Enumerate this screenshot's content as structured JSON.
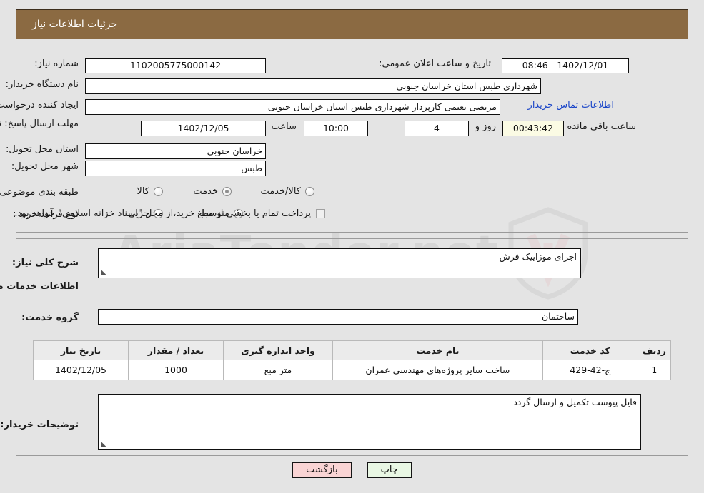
{
  "header": {
    "title": "جزئیات اطلاعات نیاز"
  },
  "top": {
    "need_number_label": "شماره نیاز:",
    "need_number_value": "1102005775000142",
    "announce_label": "تاریخ و ساعت اعلان عمومی:",
    "announce_value": "1402/12/01 - 08:46",
    "buyer_org_label": "نام دستگاه خریدار:",
    "buyer_org_value": "شهرداری طبس استان خراسان جنوبی",
    "creator_label": "ایجاد کننده درخواست:",
    "creator_value": "مرتضی نعیمی کارپرداز شهرداری طبس استان خراسان جنوبی",
    "contact_link": "اطلاعات تماس خریدار",
    "deadline_label": "مهلت ارسال پاسخ: تا تاریخ:",
    "deadline_date": "1402/12/05",
    "hour_label": "ساعت",
    "hour_value": "10:00",
    "days_value": "4",
    "days_label": "روز و",
    "countdown_value": "00:43:42",
    "countdown_label": "ساعت باقی مانده",
    "province_label": "استان محل تحویل:",
    "province_value": "خراسان جنوبی",
    "city_label": "شهر محل تحویل:",
    "city_value": "طبس",
    "category_label": "طبقه بندی موضوعی:",
    "category_options": [
      {
        "label": "کالا",
        "selected": false
      },
      {
        "label": "خدمت",
        "selected": true
      },
      {
        "label": "کالا/خدمت",
        "selected": false
      }
    ],
    "process_label": "نوع فرآیند خرید :",
    "process_options": [
      {
        "label": "جزیی",
        "selected": false
      },
      {
        "label": "متوسط",
        "selected": true
      }
    ],
    "treasury_note": "پرداخت تمام یا بخشی از مبلغ خرید،از محل \"اسناد خزانه اسلامی\" خواهد بود."
  },
  "mid": {
    "summary_label": "شرح کلی نیاز:",
    "summary_value": "اجرای موزاییک فرش",
    "services_heading": "اطلاعات خدمات مورد نیاز",
    "service_group_label": "گروه خدمت:",
    "service_group_value": "ساختمان",
    "buyer_notes_label": "توضیحات خریدار:",
    "buyer_notes_value": "فایل پیوست تکمیل و ارسال گردد"
  },
  "table": {
    "columns": [
      "ردیف",
      "کد خدمت",
      "نام خدمت",
      "واحد اندازه گیری",
      "تعداد / مقدار",
      "تاریخ نیاز"
    ],
    "rows": [
      {
        "radif": "1",
        "code": "ج-42-429",
        "name": "ساخت سایر پروژه‌های مهندسی عمران",
        "unit": "متر مبع",
        "qty": "1000",
        "date": "1402/12/05"
      }
    ]
  },
  "buttons": {
    "print": "چاپ",
    "back": "بازگشت"
  },
  "watermark": {
    "text": "AriaTender.net"
  },
  "colors": {
    "header_bg": "#8b6a42",
    "link": "#1a45c8",
    "print_btn": "#e9f7e4",
    "back_btn": "#f9d4d4",
    "countdown_bg": "#fbfbe4"
  }
}
